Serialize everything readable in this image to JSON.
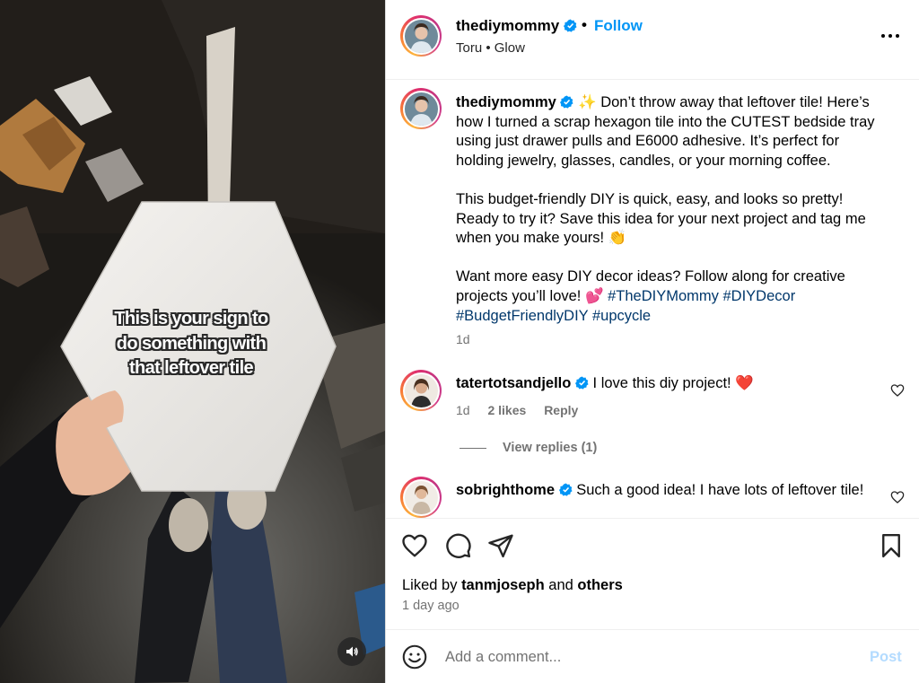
{
  "media": {
    "overlay_lines": [
      "This is your sign to",
      "do something with",
      "that leftover tile"
    ],
    "mute_icon": "speaker-icon"
  },
  "header": {
    "username": "thediymommy",
    "separator": "•",
    "follow_label": "Follow",
    "audio": "Toru • Glow",
    "more_icon": "more-options-icon"
  },
  "caption": {
    "username": "thediymommy",
    "sparkle": "✨",
    "paragraph1": "Don’t throw away that leftover tile! Here’s how I turned a scrap hexagon tile into the CUTEST bedside tray using just drawer pulls and E6000 adhesive. It’s perfect for holding jewelry, glasses, candles, or your morning coffee.",
    "paragraph2": "This budget-friendly DIY is quick, easy, and looks so pretty! Ready to try it? Save this idea for your next project and tag me when you make yours! 👏",
    "paragraph3_text": "Want more easy DIY decor ideas? Follow along for creative projects you’ll love! 💕",
    "hashtags": [
      "#TheDIYMommy",
      "#DIYDecor",
      "#BudgetFriendlyDIY",
      "#upcycle"
    ],
    "time": "1d"
  },
  "comments": [
    {
      "username": "tatertotsandjello",
      "text": "I love this diy project! ❤️",
      "time": "1d",
      "likes": "2 likes",
      "reply_label": "Reply",
      "view_replies": "View replies (1)"
    },
    {
      "username": "sobrighthome",
      "text": "Such a good idea! I have lots of leftover tile!"
    }
  ],
  "actions": {
    "liked_prefix": "Liked by",
    "liked_user": "tanmjoseph",
    "liked_and": "and",
    "liked_others": "others",
    "time_ago": "1 day ago"
  },
  "add_comment": {
    "placeholder": "Add a comment...",
    "post_label": "Post"
  },
  "colors": {
    "link_blue": "#0095f6",
    "hashtag": "#00376b",
    "muted": "#737373",
    "post_disabled": "#b3dbff",
    "heart_red": "#ed4956"
  }
}
